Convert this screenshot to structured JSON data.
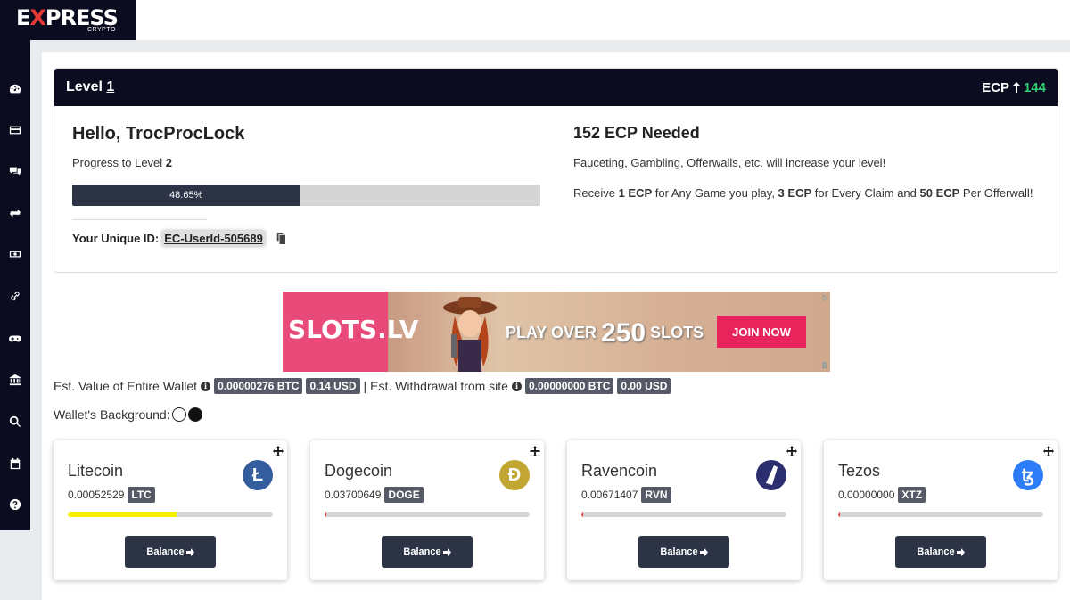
{
  "brand": {
    "name_a": "E",
    "name_x": "X",
    "name_b": "PRESS",
    "sub": "CRYPTO"
  },
  "sidebar": {
    "items": [
      {
        "icon": "dashboard-icon"
      },
      {
        "icon": "credit-card-icon"
      },
      {
        "icon": "chat-icon"
      },
      {
        "icon": "exchange-icon"
      },
      {
        "icon": "money-icon"
      },
      {
        "icon": "link-icon"
      },
      {
        "icon": "gamepad-icon"
      },
      {
        "icon": "bank-icon"
      },
      {
        "icon": "search-icon"
      },
      {
        "icon": "calendar-icon"
      },
      {
        "icon": "help-icon"
      }
    ]
  },
  "level": {
    "title": "Level",
    "number": "1",
    "ecp_label": "ECP",
    "ecp_value": "144"
  },
  "greeting": "Hello, TrocProcLock",
  "progress": {
    "label": "Progress to Level",
    "next_level": "2",
    "percent_text": "48.65%",
    "fraction": 0.4865
  },
  "user_id": {
    "label": "Your Unique ID:",
    "value": "EC-UserId-505689"
  },
  "needed": {
    "title": "152 ECP Needed",
    "subtitle": "Fauceting, Gambling, Offerwalls, etc. will increase your level!",
    "reward_a": "Receive ",
    "reward_b": "1 ECP",
    "reward_c": " for Any Game you play, ",
    "reward_d": "3 ECP",
    "reward_e": " for Every Claim and ",
    "reward_f": "50 ECP",
    "reward_g": " Per Offerwall!"
  },
  "ad": {
    "logo": "SLOTS.LV",
    "text_a": "PLAY OVER",
    "text_big": "250",
    "text_b": "SLOTS",
    "button": "JOIN NOW"
  },
  "wallet": {
    "est_label": "Est. Value of Entire Wallet",
    "btc": "0.00000276 BTC",
    "usd": "0.14 USD",
    "sep": "|",
    "withdraw_label": "Est. Withdrawal from site",
    "w_btc": "0.00000000 BTC",
    "w_usd": "0.00 USD",
    "bg_label": "Wallet's Background:"
  },
  "coins": [
    {
      "name": "Litecoin",
      "amount": "0.00052529",
      "ticker": "LTC",
      "color": "#345d9d",
      "glyph": "Ł",
      "fill": 0.53,
      "bar_color": "#f4f000",
      "button": "Balance"
    },
    {
      "name": "Dogecoin",
      "amount": "0.03700649",
      "ticker": "DOGE",
      "color": "#c2a633",
      "glyph": "Ð",
      "fill": 0.01,
      "bar_color": "#e53935",
      "button": "Balance"
    },
    {
      "name": "Ravencoin",
      "amount": "0.00671407",
      "ticker": "RVN",
      "color": "#2b2f6f",
      "glyph": "",
      "fill": 0.01,
      "bar_color": "#e53935",
      "button": "Balance"
    },
    {
      "name": "Tezos",
      "amount": "0.00000000",
      "ticker": "XTZ",
      "color": "#2c7df7",
      "glyph": "ꜩ",
      "fill": 0.01,
      "bar_color": "#e53935",
      "button": "Balance"
    }
  ]
}
